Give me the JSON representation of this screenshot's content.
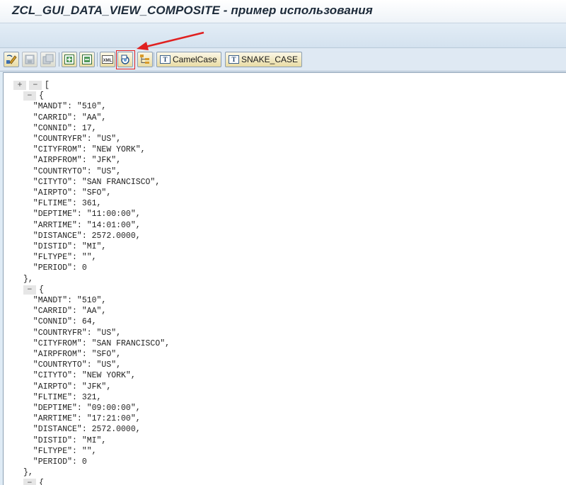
{
  "window": {
    "title": "ZCL_GUI_DATA_VIEW_COMPOSITE - пример использования"
  },
  "toolbar": {
    "buttons": [
      {
        "name": "change-icon",
        "label": ""
      },
      {
        "name": "save-icon",
        "label": ""
      },
      {
        "name": "save-as-icon",
        "label": ""
      },
      {
        "name": "expand-icon",
        "label": ""
      },
      {
        "name": "collapse-icon",
        "label": ""
      },
      {
        "name": "xml-icon",
        "label": "XML"
      },
      {
        "name": "json-icon",
        "label": ""
      },
      {
        "name": "tree-icon",
        "label": ""
      }
    ],
    "camelcase_label": "CamelCase",
    "snakecase_label": "SNAKE_CASE",
    "accent": "#e02020"
  },
  "viewer": {
    "root_controls": [
      "+",
      "−"
    ],
    "collapse_symbol": "−",
    "lines": [
      "[",
      "{",
      "  \"MANDT\": \"510\",",
      "  \"CARRID\": \"AA\",",
      "  \"CONNID\": 17,",
      "  \"COUNTRYFR\": \"US\",",
      "  \"CITYFROM\": \"NEW YORK\",",
      "  \"AIRPFROM\": \"JFK\",",
      "  \"COUNTRYTO\": \"US\",",
      "  \"CITYTO\": \"SAN FRANCISCO\",",
      "  \"AIRPTO\": \"SFO\",",
      "  \"FLTIME\": 361,",
      "  \"DEPTIME\": \"11:00:00\",",
      "  \"ARRTIME\": \"14:01:00\",",
      "  \"DISTANCE\": 2572.0000,",
      "  \"DISTID\": \"MI\",",
      "  \"FLTYPE\": \"\",",
      "  \"PERIOD\": 0",
      "},",
      "{",
      "  \"MANDT\": \"510\",",
      "  \"CARRID\": \"AA\",",
      "  \"CONNID\": 64,",
      "  \"COUNTRYFR\": \"US\",",
      "  \"CITYFROM\": \"SAN FRANCISCO\",",
      "  \"AIRPFROM\": \"SFO\",",
      "  \"COUNTRYTO\": \"US\",",
      "  \"CITYTO\": \"NEW YORK\",",
      "  \"AIRPTO\": \"JFK\",",
      "  \"FLTIME\": 321,",
      "  \"DEPTIME\": \"09:00:00\",",
      "  \"ARRTIME\": \"17:21:00\",",
      "  \"DISTANCE\": 2572.0000,",
      "  \"DISTID\": \"MI\",",
      "  \"FLTYPE\": \"\",",
      "  \"PERIOD\": 0",
      "},",
      "{"
    ]
  }
}
